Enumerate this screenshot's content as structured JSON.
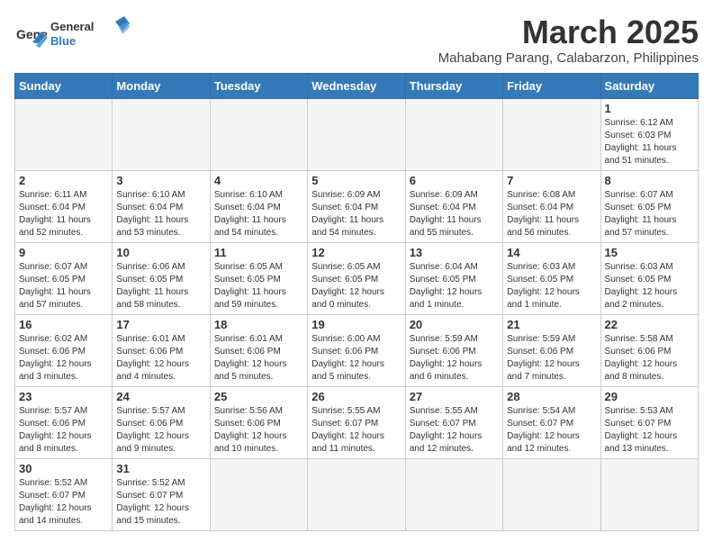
{
  "header": {
    "logo_general": "General",
    "logo_blue": "Blue",
    "month": "March 2025",
    "location": "Mahabang Parang, Calabarzon, Philippines"
  },
  "days_of_week": [
    "Sunday",
    "Monday",
    "Tuesday",
    "Wednesday",
    "Thursday",
    "Friday",
    "Saturday"
  ],
  "weeks": [
    [
      {
        "day": "",
        "info": ""
      },
      {
        "day": "",
        "info": ""
      },
      {
        "day": "",
        "info": ""
      },
      {
        "day": "",
        "info": ""
      },
      {
        "day": "",
        "info": ""
      },
      {
        "day": "",
        "info": ""
      },
      {
        "day": "1",
        "info": "Sunrise: 6:12 AM\nSunset: 6:03 PM\nDaylight: 11 hours\nand 51 minutes."
      }
    ],
    [
      {
        "day": "2",
        "info": "Sunrise: 6:11 AM\nSunset: 6:04 PM\nDaylight: 11 hours\nand 52 minutes."
      },
      {
        "day": "3",
        "info": "Sunrise: 6:10 AM\nSunset: 6:04 PM\nDaylight: 11 hours\nand 53 minutes."
      },
      {
        "day": "4",
        "info": "Sunrise: 6:10 AM\nSunset: 6:04 PM\nDaylight: 11 hours\nand 54 minutes."
      },
      {
        "day": "5",
        "info": "Sunrise: 6:09 AM\nSunset: 6:04 PM\nDaylight: 11 hours\nand 54 minutes."
      },
      {
        "day": "6",
        "info": "Sunrise: 6:09 AM\nSunset: 6:04 PM\nDaylight: 11 hours\nand 55 minutes."
      },
      {
        "day": "7",
        "info": "Sunrise: 6:08 AM\nSunset: 6:04 PM\nDaylight: 11 hours\nand 56 minutes."
      },
      {
        "day": "8",
        "info": "Sunrise: 6:07 AM\nSunset: 6:05 PM\nDaylight: 11 hours\nand 57 minutes."
      }
    ],
    [
      {
        "day": "9",
        "info": "Sunrise: 6:07 AM\nSunset: 6:05 PM\nDaylight: 11 hours\nand 57 minutes."
      },
      {
        "day": "10",
        "info": "Sunrise: 6:06 AM\nSunset: 6:05 PM\nDaylight: 11 hours\nand 58 minutes."
      },
      {
        "day": "11",
        "info": "Sunrise: 6:05 AM\nSunset: 6:05 PM\nDaylight: 11 hours\nand 59 minutes."
      },
      {
        "day": "12",
        "info": "Sunrise: 6:05 AM\nSunset: 6:05 PM\nDaylight: 12 hours\nand 0 minutes."
      },
      {
        "day": "13",
        "info": "Sunrise: 6:04 AM\nSunset: 6:05 PM\nDaylight: 12 hours\nand 1 minute."
      },
      {
        "day": "14",
        "info": "Sunrise: 6:03 AM\nSunset: 6:05 PM\nDaylight: 12 hours\nand 1 minute."
      },
      {
        "day": "15",
        "info": "Sunrise: 6:03 AM\nSunset: 6:05 PM\nDaylight: 12 hours\nand 2 minutes."
      }
    ],
    [
      {
        "day": "16",
        "info": "Sunrise: 6:02 AM\nSunset: 6:06 PM\nDaylight: 12 hours\nand 3 minutes."
      },
      {
        "day": "17",
        "info": "Sunrise: 6:01 AM\nSunset: 6:06 PM\nDaylight: 12 hours\nand 4 minutes."
      },
      {
        "day": "18",
        "info": "Sunrise: 6:01 AM\nSunset: 6:06 PM\nDaylight: 12 hours\nand 5 minutes."
      },
      {
        "day": "19",
        "info": "Sunrise: 6:00 AM\nSunset: 6:06 PM\nDaylight: 12 hours\nand 5 minutes."
      },
      {
        "day": "20",
        "info": "Sunrise: 5:59 AM\nSunset: 6:06 PM\nDaylight: 12 hours\nand 6 minutes."
      },
      {
        "day": "21",
        "info": "Sunrise: 5:59 AM\nSunset: 6:06 PM\nDaylight: 12 hours\nand 7 minutes."
      },
      {
        "day": "22",
        "info": "Sunrise: 5:58 AM\nSunset: 6:06 PM\nDaylight: 12 hours\nand 8 minutes."
      }
    ],
    [
      {
        "day": "23",
        "info": "Sunrise: 5:57 AM\nSunset: 6:06 PM\nDaylight: 12 hours\nand 8 minutes."
      },
      {
        "day": "24",
        "info": "Sunrise: 5:57 AM\nSunset: 6:06 PM\nDaylight: 12 hours\nand 9 minutes."
      },
      {
        "day": "25",
        "info": "Sunrise: 5:56 AM\nSunset: 6:06 PM\nDaylight: 12 hours\nand 10 minutes."
      },
      {
        "day": "26",
        "info": "Sunrise: 5:55 AM\nSunset: 6:07 PM\nDaylight: 12 hours\nand 11 minutes."
      },
      {
        "day": "27",
        "info": "Sunrise: 5:55 AM\nSunset: 6:07 PM\nDaylight: 12 hours\nand 12 minutes."
      },
      {
        "day": "28",
        "info": "Sunrise: 5:54 AM\nSunset: 6:07 PM\nDaylight: 12 hours\nand 12 minutes."
      },
      {
        "day": "29",
        "info": "Sunrise: 5:53 AM\nSunset: 6:07 PM\nDaylight: 12 hours\nand 13 minutes."
      }
    ],
    [
      {
        "day": "30",
        "info": "Sunrise: 5:52 AM\nSunset: 6:07 PM\nDaylight: 12 hours\nand 14 minutes."
      },
      {
        "day": "31",
        "info": "Sunrise: 5:52 AM\nSunset: 6:07 PM\nDaylight: 12 hours\nand 15 minutes."
      },
      {
        "day": "",
        "info": ""
      },
      {
        "day": "",
        "info": ""
      },
      {
        "day": "",
        "info": ""
      },
      {
        "day": "",
        "info": ""
      },
      {
        "day": "",
        "info": ""
      }
    ]
  ]
}
